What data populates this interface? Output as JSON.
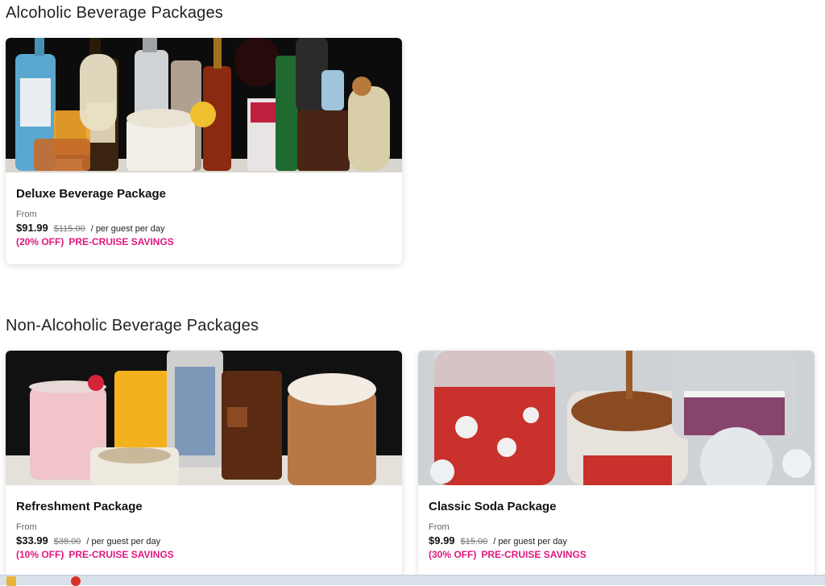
{
  "sections": {
    "alcoholic": {
      "title": "Alcoholic Beverage Packages",
      "cards": [
        {
          "name": "Deluxe Beverage Package",
          "from": "From",
          "price": "$91.99",
          "original": "$115.00",
          "per": "/ per guest per day",
          "discount": "(20% OFF)",
          "savings": "PRE-CRUISE SAVINGS"
        }
      ]
    },
    "non_alcoholic": {
      "title": "Non-Alcoholic Beverage Packages",
      "cards": [
        {
          "name": "Refreshment Package",
          "from": "From",
          "price": "$33.99",
          "original": "$38.00",
          "per": "/ per guest per day",
          "discount": "(10% OFF)",
          "savings": "PRE-CRUISE SAVINGS"
        },
        {
          "name": "Classic Soda Package",
          "from": "From",
          "price": "$9.99",
          "original": "$15.00",
          "per": "/ per guest per day",
          "discount": "(30% OFF)",
          "savings": "PRE-CRUISE SAVINGS"
        }
      ]
    }
  },
  "colors": {
    "accent": "#e0177d",
    "text": "#111111",
    "muted": "#666666"
  }
}
